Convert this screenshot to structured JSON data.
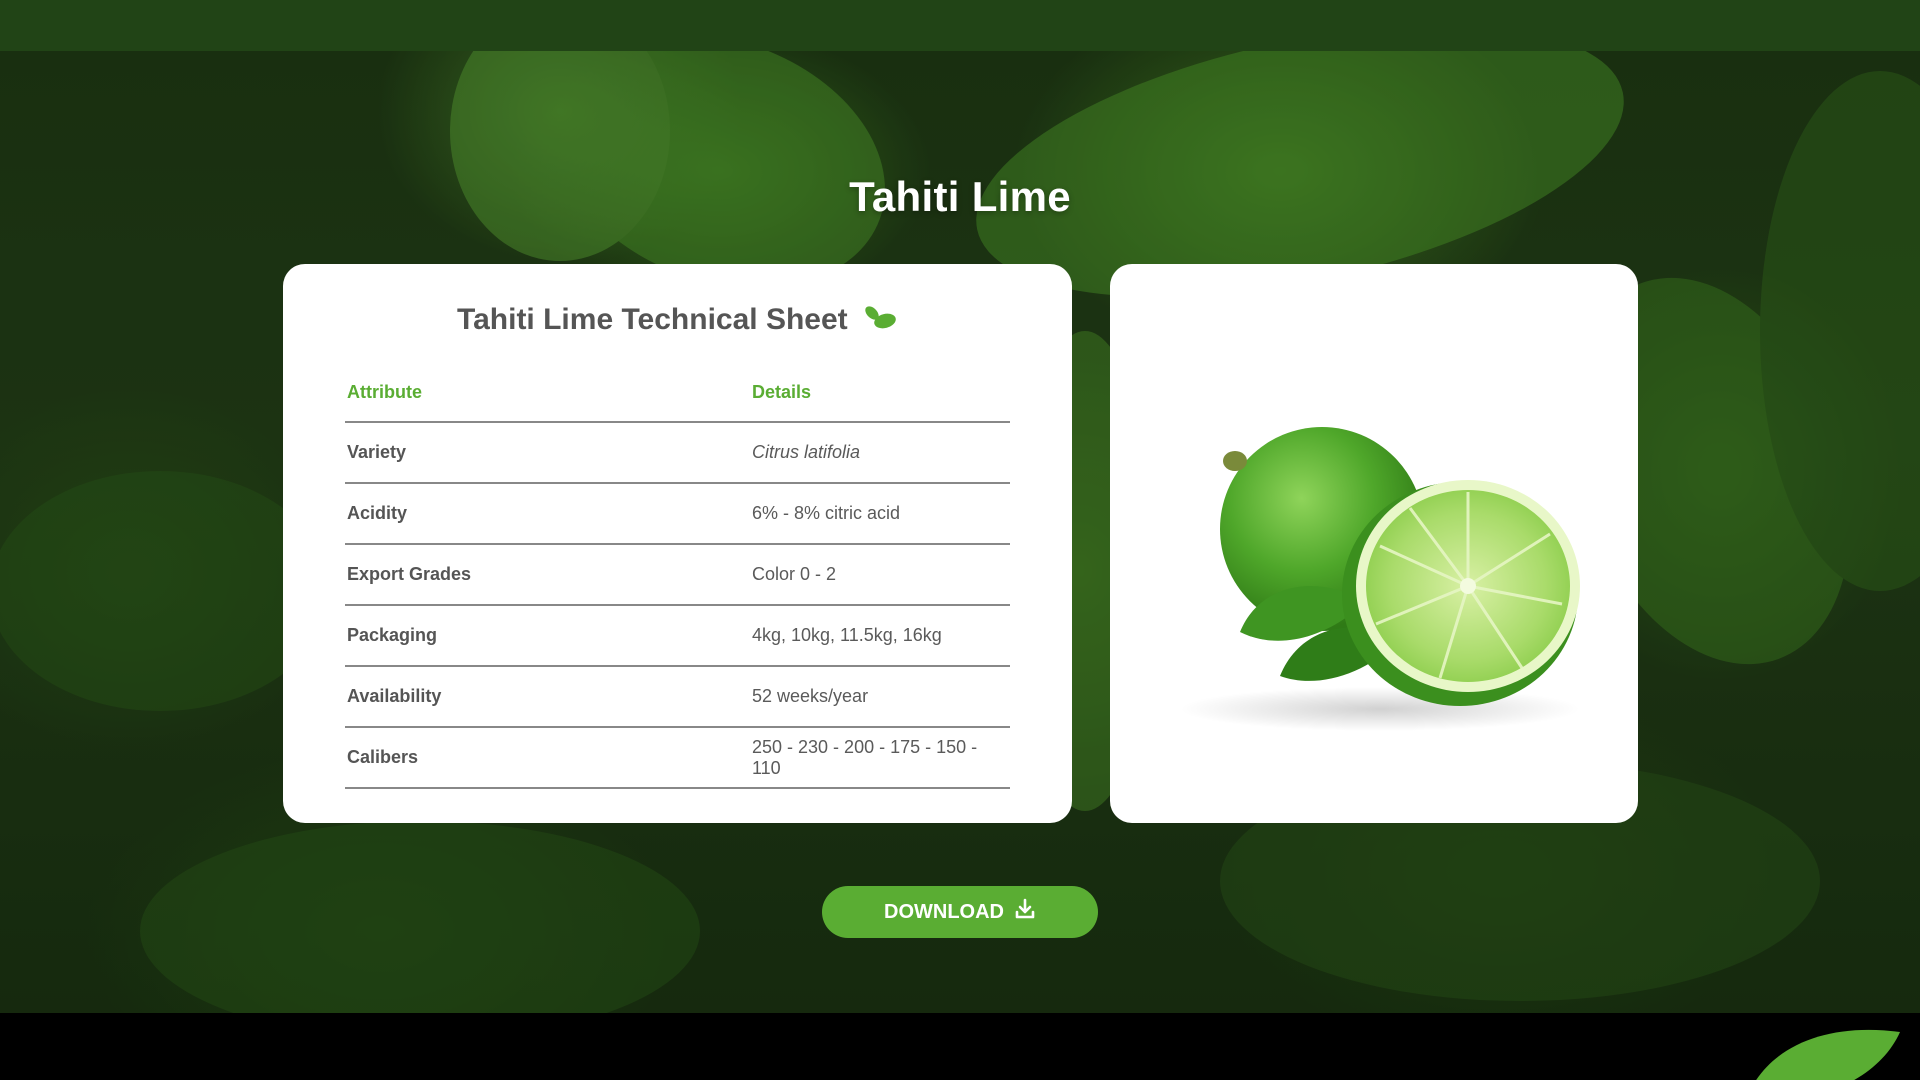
{
  "hero": {
    "title": "Tahiti Lime"
  },
  "sheet": {
    "title": "Tahiti Lime Technical Sheet",
    "headers": {
      "attribute": "Attribute",
      "details": "Details"
    },
    "rows": [
      {
        "attribute": "Variety",
        "details": "Citrus latifolia"
      },
      {
        "attribute": "Acidity",
        "details": "6% - 8% citric acid"
      },
      {
        "attribute": "Export Grades",
        "details": "Color 0 - 2"
      },
      {
        "attribute": "Packaging",
        "details": "4kg, 10kg, 11.5kg, 16kg"
      },
      {
        "attribute": "Availability",
        "details": "52 weeks/year"
      },
      {
        "attribute": "Calibers",
        "details": "250 - 230 - 200 - 175 - 150 - 110"
      }
    ]
  },
  "download": {
    "label": "DOWNLOAD",
    "icon": "download-icon"
  },
  "colors": {
    "topbar": "#214416",
    "accent": "#5aad33",
    "text": "#555555",
    "footer": "#000000"
  }
}
